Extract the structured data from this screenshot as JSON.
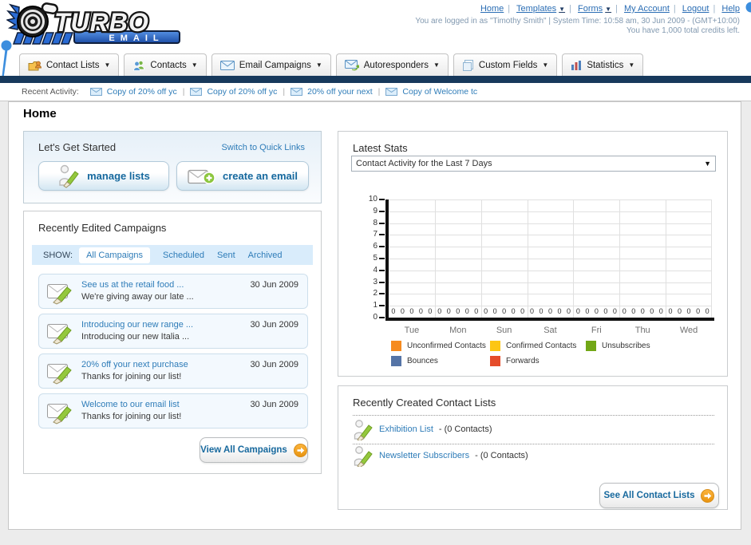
{
  "header": {
    "nav_links": [
      {
        "label": "Home",
        "caret": false
      },
      {
        "label": "Templates",
        "caret": true
      },
      {
        "label": "Forms",
        "caret": true
      },
      {
        "label": "My Account",
        "caret": false
      },
      {
        "label": "Logout",
        "caret": false
      },
      {
        "label": "Help",
        "caret": false
      }
    ],
    "login_info": "You are logged in as \"Timothy Smith\" | System Time: 10:58 am, 30 Jun 2009 - (GMT+10:00)",
    "credits_info": "You have 1,000 total credits left.",
    "logo_title": "TURBO",
    "logo_subtitle": "EMAIL"
  },
  "nav_tabs": [
    {
      "label": "Contact Lists"
    },
    {
      "label": "Contacts"
    },
    {
      "label": "Email Campaigns"
    },
    {
      "label": "Autoresponders"
    },
    {
      "label": "Custom Fields"
    },
    {
      "label": "Statistics"
    }
  ],
  "recent_activity": {
    "label": "Recent Activity:",
    "items": [
      "Copy of 20% off yc",
      "Copy of 20% off yc",
      "20% off your next",
      "Copy of Welcome tc"
    ]
  },
  "page_title": "Home",
  "get_started": {
    "title": "Let's Get Started",
    "switch_link": "Switch to Quick Links",
    "manage_lists_label": "manage lists",
    "create_email_label": "create an email"
  },
  "campaigns": {
    "title": "Recently Edited Campaigns",
    "show_label": "SHOW:",
    "tabs": [
      "All Campaigns",
      "Scheduled",
      "Sent",
      "Archived"
    ],
    "active_tab": "All Campaigns",
    "rows": [
      {
        "title": "See us at the retail food ...",
        "subtitle": "We're giving away our late ...",
        "date": "30 Jun 2009"
      },
      {
        "title": "Introducing our new range ...",
        "subtitle": "Introducing our new Italia ...",
        "date": "30 Jun 2009"
      },
      {
        "title": "20% off your next purchase",
        "subtitle": "Thanks for joining our list!",
        "date": "30 Jun 2009"
      },
      {
        "title": "Welcome to our email list",
        "subtitle": "Thanks for joining our list!",
        "date": "30 Jun 2009"
      }
    ],
    "view_all_label": "View All Campaigns"
  },
  "stats": {
    "title": "Latest Stats",
    "dropdown_value": "Contact Activity for the Last 7 Days"
  },
  "chart_data": {
    "type": "bar",
    "categories": [
      "Tue",
      "Mon",
      "Sun",
      "Sat",
      "Fri",
      "Thu",
      "Wed"
    ],
    "series": [
      {
        "name": "Unconfirmed Contacts",
        "color": "#f68b1f",
        "values": [
          0,
          0,
          0,
          0,
          0,
          0,
          0
        ]
      },
      {
        "name": "Confirmed Contacts",
        "color": "#fdc613",
        "values": [
          0,
          0,
          0,
          0,
          0,
          0,
          0
        ]
      },
      {
        "name": "Unsubscribes",
        "color": "#72a716",
        "values": [
          0,
          0,
          0,
          0,
          0,
          0,
          0
        ]
      },
      {
        "name": "Bounces",
        "color": "#5574a6",
        "values": [
          0,
          0,
          0,
          0,
          0,
          0,
          0
        ]
      },
      {
        "name": "Forwards",
        "color": "#e54c2a",
        "values": [
          0,
          0,
          0,
          0,
          0,
          0,
          0
        ]
      }
    ],
    "title": "Contact Activity for the Last 7 Days",
    "xlabel": "",
    "ylabel": "",
    "ylim": [
      0,
      10
    ],
    "yticks": [
      0,
      1,
      2,
      3,
      4,
      5,
      6,
      7,
      8,
      9,
      10
    ],
    "grid": true,
    "legend_position": "bottom"
  },
  "contact_lists": {
    "title": "Recently Created Contact Lists",
    "items": [
      {
        "name": "Exhibition List",
        "count": "- (0 Contacts)"
      },
      {
        "name": "Newsletter Subscribers",
        "count": "- (0 Contacts)"
      }
    ],
    "see_all_label": "See All Contact Lists"
  }
}
